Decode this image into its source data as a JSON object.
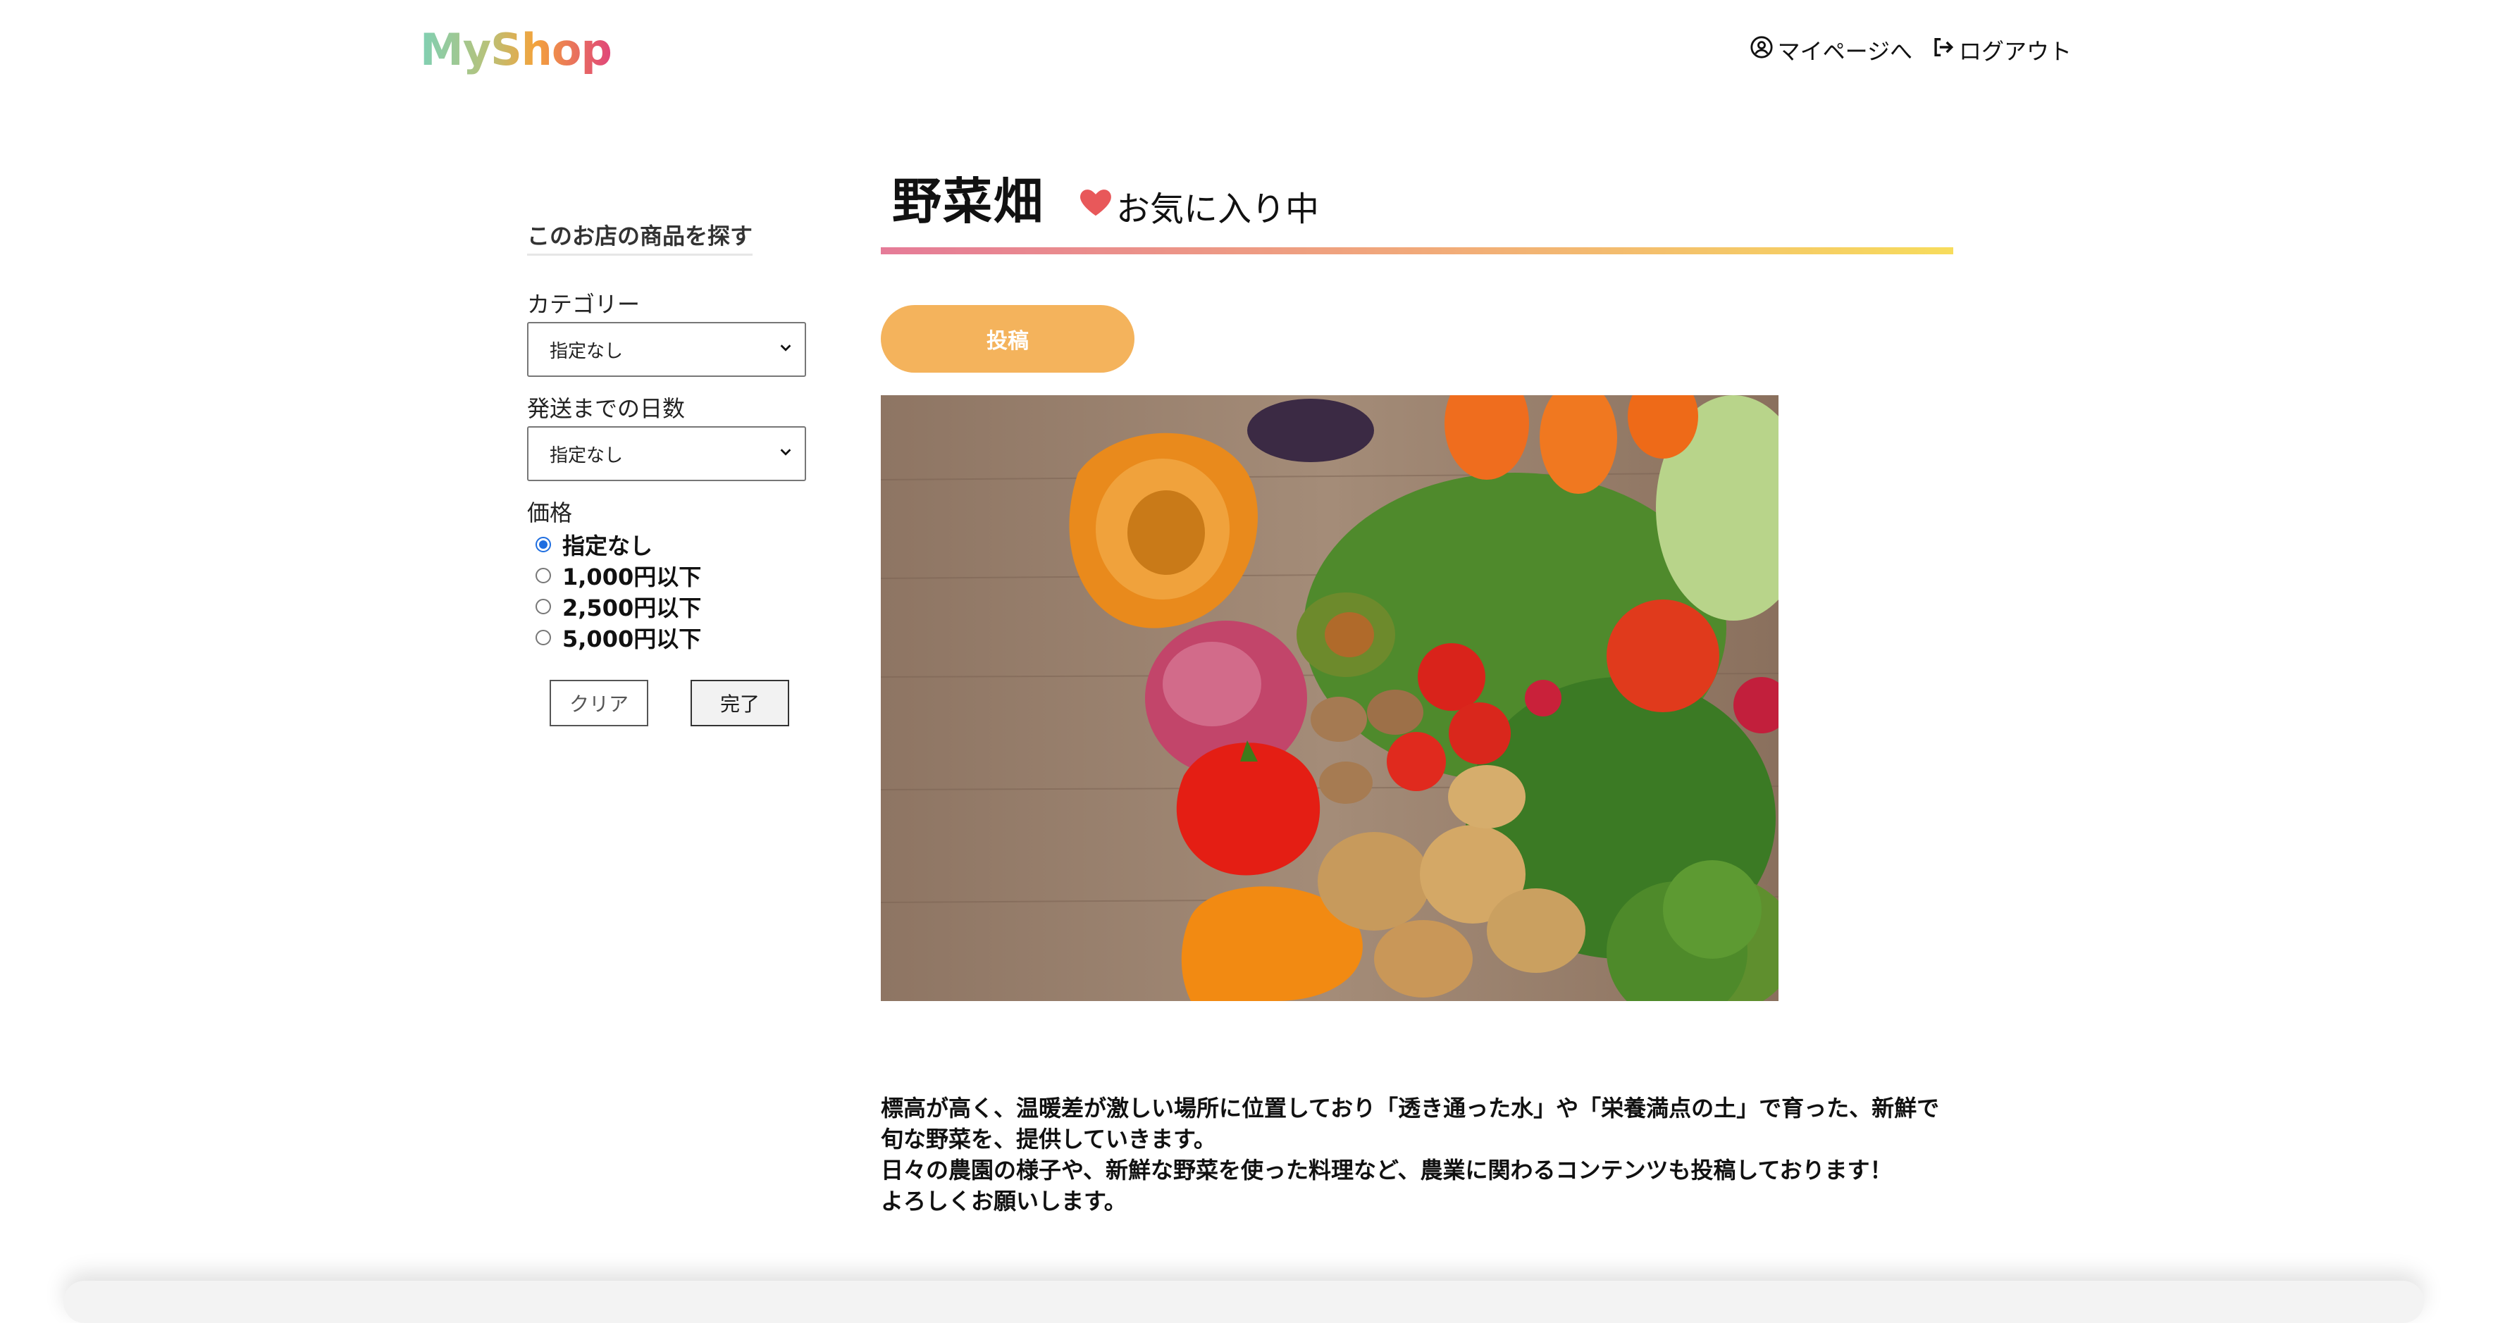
{
  "header": {
    "logo_text": "MyShop",
    "mypage_label": "マイページへ",
    "logout_label": "ログアウト"
  },
  "sidebar": {
    "title": "このお店の商品を探す",
    "category_label": "カテゴリー",
    "category_value": "指定なし",
    "shipping_label": "発送までの日数",
    "shipping_value": "指定なし",
    "price_label": "価格",
    "price_options": [
      {
        "label": "指定なし",
        "checked": true
      },
      {
        "label": "1,000円以下",
        "checked": false
      },
      {
        "label": "2,500円以下",
        "checked": false
      },
      {
        "label": "5,000円以下",
        "checked": false
      }
    ],
    "clear_label": "クリア",
    "done_label": "完了"
  },
  "main": {
    "shop_name": "野菜畑",
    "favorite_label": "お気に入り中",
    "post_label": "投稿",
    "image_alt": "vegetables-photo",
    "description": [
      "標高が高く、温暖差が激しい場所に位置しており「透き通った水」や「栄養満点の土」で育った、新鮮で",
      "旬な野菜を、提供していきます。",
      "日々の農園の様子や、新鮮な野菜を使った料理など、農業に関わるコンテンツも投稿しております！",
      "よろしくお願いします。"
    ]
  },
  "colors": {
    "accent_orange": "#f4b35c",
    "heart_red": "#e8585a",
    "radio_blue": "#1f6ee0"
  }
}
